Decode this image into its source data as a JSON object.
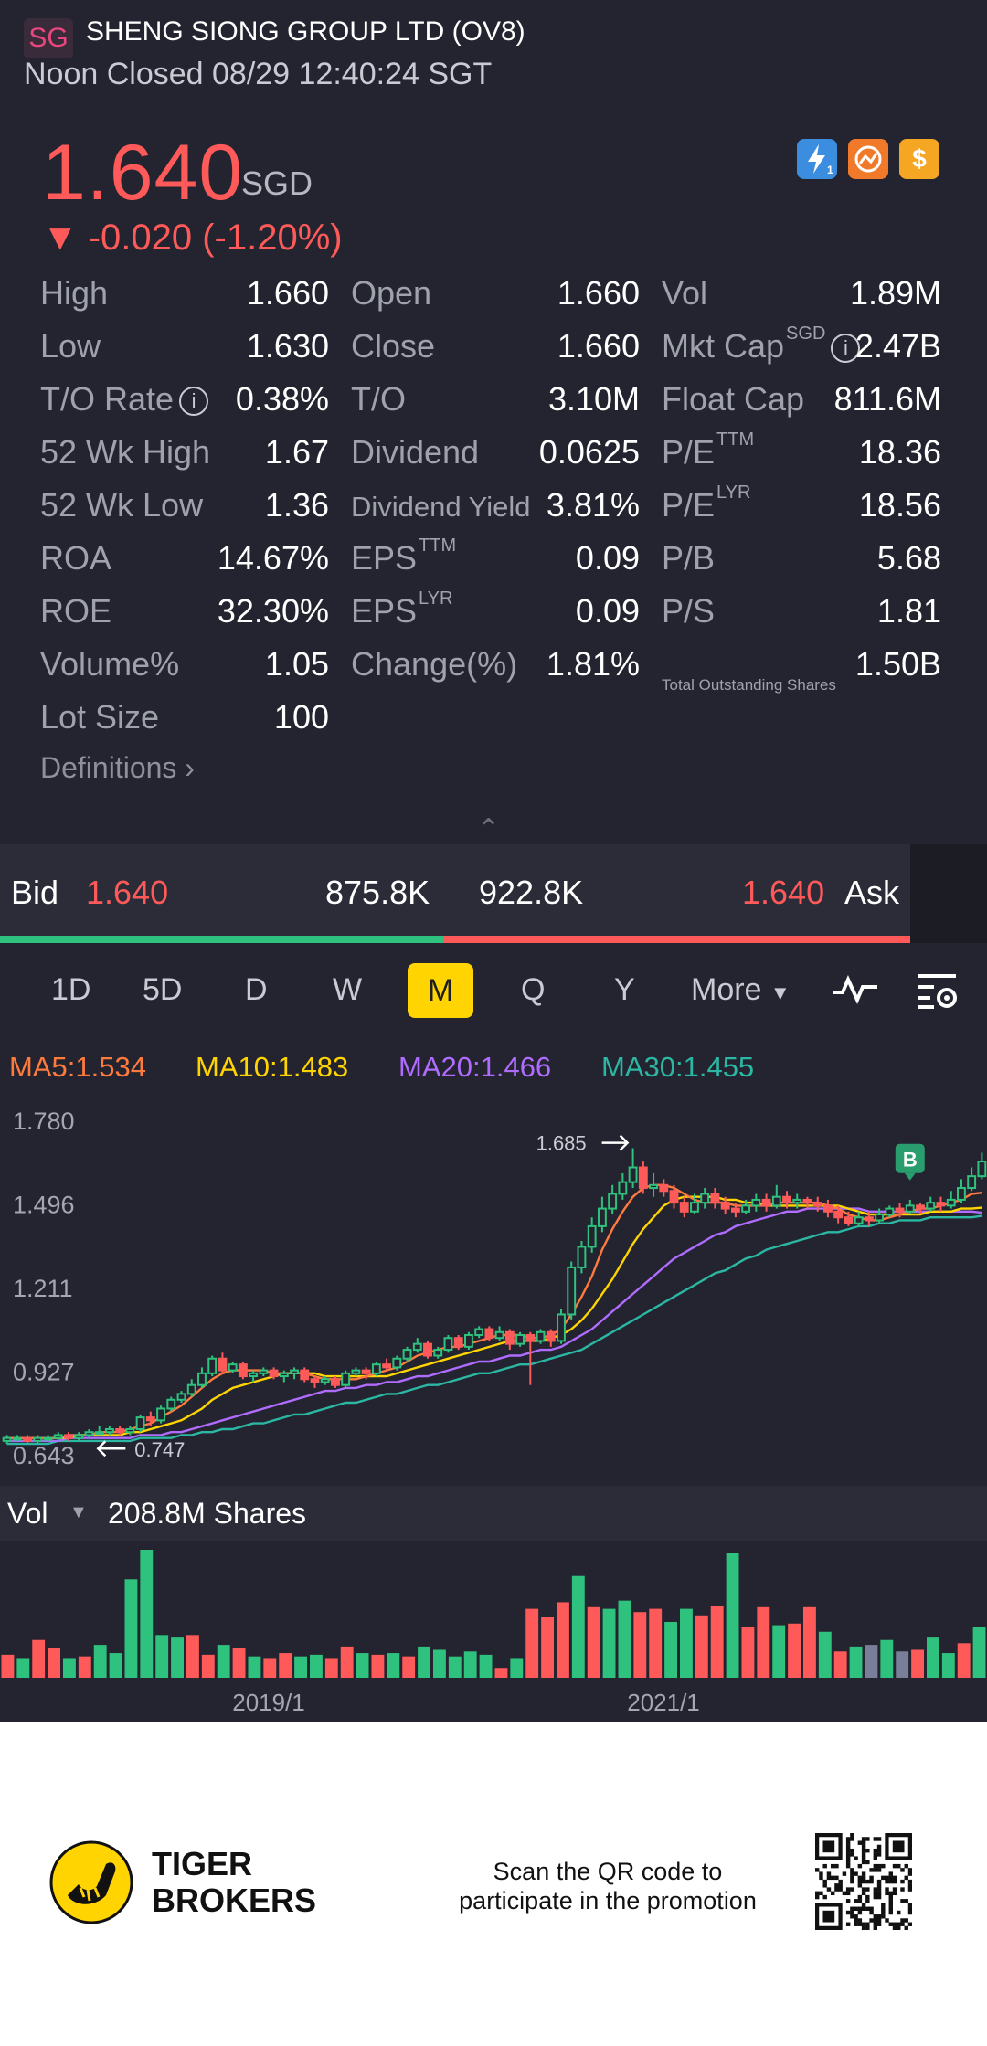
{
  "header": {
    "logo_text": "SG",
    "title": "SHENG SIONG GROUP LTD (OV8)",
    "status": "Noon Closed 08/29 12:40:24 SGT"
  },
  "quote": {
    "price": "1.640",
    "currency": "SGD",
    "change": "▼ -0.020 (-1.20%)",
    "badges": [
      {
        "name": "lightning-level1-icon",
        "color": "#3b8de0"
      },
      {
        "name": "options-icon",
        "color": "#f07a2a"
      },
      {
        "name": "dollar-icon",
        "color": "#f5a623"
      }
    ]
  },
  "stats": {
    "col1": [
      {
        "label": "High",
        "value": "1.660"
      },
      {
        "label": "Low",
        "value": "1.630"
      },
      {
        "label": "T/O Rate",
        "value": "0.38%"
      },
      {
        "label": "52 Wk High",
        "value": "1.67"
      },
      {
        "label": "52 Wk Low",
        "value": "1.36"
      },
      {
        "label": "ROA",
        "value": "14.67%"
      },
      {
        "label": "ROE",
        "value": "32.30%"
      },
      {
        "label": "Volume%",
        "value": "1.05"
      },
      {
        "label": "Lot Size",
        "value": "100"
      }
    ],
    "col2": [
      {
        "label": "Open",
        "value": "1.660"
      },
      {
        "label": "Close",
        "value": "1.660"
      },
      {
        "label": "T/O",
        "value": "3.10M"
      },
      {
        "label": "Dividend",
        "value": "0.0625"
      },
      {
        "label": "Dividend Yield",
        "value": "3.81%"
      },
      {
        "label": "EPS",
        "sup": "TTM",
        "value": "0.09"
      },
      {
        "label": "EPS",
        "sup": "LYR",
        "value": "0.09"
      },
      {
        "label": "Change(%)",
        "value": "1.81%"
      }
    ],
    "col3": [
      {
        "label": "Vol",
        "value": "1.89M"
      },
      {
        "label": "Mkt Cap",
        "sup": "SGD",
        "value": "2.47B"
      },
      {
        "label": "Float Cap",
        "value": "811.6M"
      },
      {
        "label": "P/E",
        "sup": "TTM",
        "value": "18.36"
      },
      {
        "label": "P/E",
        "sup": "LYR",
        "value": "18.56"
      },
      {
        "label": "P/B",
        "value": "5.68"
      },
      {
        "label": "P/S",
        "value": "1.81"
      },
      {
        "label": "Total Outstanding Shares",
        "value": "1.50B"
      }
    ],
    "definitions_label": "Definitions"
  },
  "bidask": {
    "bid_label": "Bid",
    "bid_price": "1.640",
    "bid_size": "875.8K",
    "ask_size": "922.8K",
    "ask_price": "1.640",
    "ask_label": "Ask",
    "bid_ratio": 0.487
  },
  "periods": {
    "items": [
      "1D",
      "5D",
      "D",
      "W",
      "M",
      "Q",
      "Y",
      "More"
    ],
    "selected": "M"
  },
  "ma": [
    {
      "label": "MA5:1.534",
      "color": "#ff7a3d"
    },
    {
      "label": "MA10:1.483",
      "color": "#ffd400"
    },
    {
      "label": "MA20:1.466",
      "color": "#b06cff"
    },
    {
      "label": "MA30:1.455",
      "color": "#2bb7a3"
    }
  ],
  "chart_data": {
    "type": "candlestick",
    "y_ticks": [
      "1.780",
      "1.496",
      "1.211",
      "0.927",
      "0.643"
    ],
    "ylim": [
      0.643,
      1.78
    ],
    "high_annotation": "1.685",
    "low_annotation": "0.747",
    "marker_label": "B",
    "x_labels": [
      "2019/1",
      "2021/1"
    ],
    "candles": [
      [
        0.69,
        0.7,
        0.68,
        0.71
      ],
      [
        0.7,
        0.7,
        0.69,
        0.71
      ],
      [
        0.7,
        0.69,
        0.68,
        0.71
      ],
      [
        0.69,
        0.7,
        0.68,
        0.71
      ],
      [
        0.7,
        0.7,
        0.69,
        0.71
      ],
      [
        0.7,
        0.71,
        0.69,
        0.72
      ],
      [
        0.71,
        0.7,
        0.69,
        0.72
      ],
      [
        0.7,
        0.71,
        0.69,
        0.72
      ],
      [
        0.71,
        0.72,
        0.7,
        0.73
      ],
      [
        0.72,
        0.72,
        0.71,
        0.74
      ],
      [
        0.72,
        0.73,
        0.71,
        0.74
      ],
      [
        0.73,
        0.72,
        0.71,
        0.74
      ],
      [
        0.72,
        0.73,
        0.71,
        0.74
      ],
      [
        0.73,
        0.77,
        0.72,
        0.78
      ],
      [
        0.77,
        0.76,
        0.74,
        0.79
      ],
      [
        0.76,
        0.8,
        0.75,
        0.81
      ],
      [
        0.8,
        0.83,
        0.79,
        0.84
      ],
      [
        0.83,
        0.85,
        0.82,
        0.86
      ],
      [
        0.85,
        0.88,
        0.84,
        0.9
      ],
      [
        0.88,
        0.92,
        0.87,
        0.94
      ],
      [
        0.92,
        0.97,
        0.91,
        0.98
      ],
      [
        0.97,
        0.93,
        0.92,
        0.99
      ],
      [
        0.93,
        0.95,
        0.92,
        0.96
      ],
      [
        0.95,
        0.91,
        0.9,
        0.96
      ],
      [
        0.91,
        0.92,
        0.89,
        0.93
      ],
      [
        0.92,
        0.93,
        0.91,
        0.94
      ],
      [
        0.93,
        0.91,
        0.9,
        0.94
      ],
      [
        0.91,
        0.92,
        0.89,
        0.93
      ],
      [
        0.92,
        0.93,
        0.9,
        0.94
      ],
      [
        0.93,
        0.9,
        0.89,
        0.94
      ],
      [
        0.9,
        0.89,
        0.87,
        0.91
      ],
      [
        0.89,
        0.9,
        0.88,
        0.91
      ],
      [
        0.9,
        0.88,
        0.87,
        0.91
      ],
      [
        0.88,
        0.92,
        0.87,
        0.93
      ],
      [
        0.92,
        0.93,
        0.91,
        0.94
      ],
      [
        0.93,
        0.92,
        0.9,
        0.94
      ],
      [
        0.92,
        0.95,
        0.91,
        0.96
      ],
      [
        0.95,
        0.94,
        0.93,
        0.97
      ],
      [
        0.94,
        0.97,
        0.93,
        0.98
      ],
      [
        0.97,
        1.0,
        0.96,
        1.01
      ],
      [
        1.0,
        1.02,
        0.99,
        1.04
      ],
      [
        1.02,
        0.98,
        0.97,
        1.03
      ],
      [
        0.98,
        1.0,
        0.97,
        1.01
      ],
      [
        1.0,
        1.04,
        0.99,
        1.05
      ],
      [
        1.04,
        1.01,
        1.0,
        1.05
      ],
      [
        1.01,
        1.05,
        1.0,
        1.06
      ],
      [
        1.05,
        1.07,
        1.04,
        1.08
      ],
      [
        1.07,
        1.04,
        1.03,
        1.08
      ],
      [
        1.04,
        1.06,
        1.03,
        1.08
      ],
      [
        1.06,
        1.02,
        1.0,
        1.07
      ],
      [
        1.02,
        1.05,
        1.01,
        1.06
      ],
      [
        1.05,
        1.03,
        0.88,
        1.06
      ],
      [
        1.03,
        1.06,
        1.02,
        1.07
      ],
      [
        1.06,
        1.03,
        1.01,
        1.07
      ],
      [
        1.03,
        1.12,
        1.02,
        1.14
      ],
      [
        1.12,
        1.28,
        1.1,
        1.3
      ],
      [
        1.28,
        1.35,
        1.26,
        1.37
      ],
      [
        1.35,
        1.42,
        1.33,
        1.45
      ],
      [
        1.42,
        1.48,
        1.4,
        1.52
      ],
      [
        1.48,
        1.53,
        1.46,
        1.56
      ],
      [
        1.53,
        1.57,
        1.51,
        1.6
      ],
      [
        1.57,
        1.62,
        1.55,
        1.685
      ],
      [
        1.62,
        1.55,
        1.53,
        1.64
      ],
      [
        1.55,
        1.56,
        1.52,
        1.6
      ],
      [
        1.56,
        1.54,
        1.52,
        1.58
      ],
      [
        1.54,
        1.5,
        1.48,
        1.56
      ],
      [
        1.5,
        1.47,
        1.45,
        1.52
      ],
      [
        1.47,
        1.5,
        1.46,
        1.53
      ],
      [
        1.5,
        1.53,
        1.48,
        1.55
      ],
      [
        1.53,
        1.5,
        1.48,
        1.55
      ],
      [
        1.5,
        1.48,
        1.46,
        1.52
      ],
      [
        1.48,
        1.47,
        1.45,
        1.5
      ],
      [
        1.47,
        1.49,
        1.46,
        1.51
      ],
      [
        1.49,
        1.51,
        1.47,
        1.53
      ],
      [
        1.51,
        1.49,
        1.47,
        1.53
      ],
      [
        1.49,
        1.52,
        1.48,
        1.56
      ],
      [
        1.52,
        1.5,
        1.48,
        1.54
      ],
      [
        1.5,
        1.51,
        1.48,
        1.53
      ],
      [
        1.51,
        1.5,
        1.48,
        1.52
      ],
      [
        1.5,
        1.49,
        1.47,
        1.52
      ],
      [
        1.49,
        1.47,
        1.45,
        1.51
      ],
      [
        1.47,
        1.45,
        1.43,
        1.49
      ],
      [
        1.45,
        1.43,
        1.42,
        1.47
      ],
      [
        1.43,
        1.45,
        1.42,
        1.47
      ],
      [
        1.45,
        1.44,
        1.42,
        1.47
      ],
      [
        1.44,
        1.46,
        1.43,
        1.48
      ],
      [
        1.46,
        1.48,
        1.45,
        1.49
      ],
      [
        1.48,
        1.47,
        1.45,
        1.5
      ],
      [
        1.47,
        1.49,
        1.46,
        1.51
      ],
      [
        1.49,
        1.48,
        1.46,
        1.5
      ],
      [
        1.48,
        1.5,
        1.47,
        1.52
      ],
      [
        1.5,
        1.49,
        1.47,
        1.52
      ],
      [
        1.49,
        1.51,
        1.48,
        1.54
      ],
      [
        1.51,
        1.55,
        1.5,
        1.58
      ],
      [
        1.55,
        1.59,
        1.54,
        1.62
      ],
      [
        1.59,
        1.64,
        1.58,
        1.67
      ]
    ],
    "ma5": [
      0.7,
      0.7,
      0.7,
      0.7,
      0.7,
      0.7,
      0.71,
      0.71,
      0.71,
      0.72,
      0.72,
      0.72,
      0.73,
      0.74,
      0.75,
      0.77,
      0.79,
      0.81,
      0.84,
      0.87,
      0.9,
      0.92,
      0.93,
      0.93,
      0.93,
      0.93,
      0.92,
      0.92,
      0.92,
      0.92,
      0.91,
      0.9,
      0.9,
      0.9,
      0.9,
      0.91,
      0.92,
      0.93,
      0.94,
      0.96,
      0.98,
      0.99,
      1.0,
      1.01,
      1.01,
      1.02,
      1.03,
      1.04,
      1.05,
      1.05,
      1.05,
      1.04,
      1.04,
      1.05,
      1.07,
      1.12,
      1.18,
      1.25,
      1.34,
      1.41,
      1.47,
      1.52,
      1.55,
      1.56,
      1.56,
      1.55,
      1.53,
      1.51,
      1.5,
      1.5,
      1.5,
      1.49,
      1.49,
      1.49,
      1.49,
      1.5,
      1.5,
      1.5,
      1.5,
      1.5,
      1.49,
      1.48,
      1.46,
      1.45,
      1.44,
      1.44,
      1.45,
      1.46,
      1.47,
      1.48,
      1.48,
      1.49,
      1.5,
      1.51,
      1.53,
      1.534
    ],
    "ma10": [
      0.7,
      0.7,
      0.7,
      0.7,
      0.7,
      0.7,
      0.7,
      0.71,
      0.71,
      0.71,
      0.71,
      0.71,
      0.72,
      0.72,
      0.73,
      0.74,
      0.75,
      0.76,
      0.78,
      0.8,
      0.83,
      0.85,
      0.87,
      0.88,
      0.89,
      0.9,
      0.91,
      0.92,
      0.92,
      0.92,
      0.92,
      0.91,
      0.91,
      0.91,
      0.91,
      0.91,
      0.91,
      0.91,
      0.92,
      0.93,
      0.94,
      0.95,
      0.96,
      0.97,
      0.98,
      0.99,
      1.0,
      1.01,
      1.02,
      1.03,
      1.03,
      1.03,
      1.03,
      1.04,
      1.05,
      1.07,
      1.1,
      1.14,
      1.19,
      1.24,
      1.3,
      1.36,
      1.41,
      1.45,
      1.49,
      1.51,
      1.52,
      1.52,
      1.52,
      1.52,
      1.51,
      1.51,
      1.5,
      1.5,
      1.49,
      1.49,
      1.49,
      1.49,
      1.49,
      1.49,
      1.49,
      1.49,
      1.48,
      1.47,
      1.46,
      1.46,
      1.46,
      1.46,
      1.46,
      1.46,
      1.47,
      1.47,
      1.47,
      1.48,
      1.48,
      1.483
    ],
    "ma20": [
      0.69,
      0.69,
      0.69,
      0.69,
      0.69,
      0.69,
      0.7,
      0.7,
      0.7,
      0.7,
      0.7,
      0.7,
      0.7,
      0.71,
      0.71,
      0.71,
      0.72,
      0.72,
      0.73,
      0.74,
      0.75,
      0.76,
      0.77,
      0.78,
      0.79,
      0.8,
      0.81,
      0.82,
      0.83,
      0.84,
      0.85,
      0.86,
      0.86,
      0.87,
      0.87,
      0.88,
      0.88,
      0.89,
      0.89,
      0.9,
      0.91,
      0.91,
      0.92,
      0.93,
      0.94,
      0.95,
      0.96,
      0.96,
      0.97,
      0.98,
      0.98,
      0.99,
      1.0,
      1.0,
      1.01,
      1.03,
      1.05,
      1.07,
      1.1,
      1.13,
      1.16,
      1.19,
      1.22,
      1.25,
      1.28,
      1.31,
      1.33,
      1.35,
      1.37,
      1.39,
      1.4,
      1.42,
      1.43,
      1.44,
      1.45,
      1.46,
      1.47,
      1.47,
      1.48,
      1.48,
      1.48,
      1.48,
      1.48,
      1.48,
      1.47,
      1.47,
      1.47,
      1.47,
      1.47,
      1.47,
      1.47,
      1.47,
      1.47,
      1.47,
      1.47,
      1.466
    ],
    "ma30": [
      0.68,
      0.68,
      0.68,
      0.68,
      0.68,
      0.69,
      0.69,
      0.69,
      0.69,
      0.69,
      0.69,
      0.69,
      0.69,
      0.7,
      0.7,
      0.7,
      0.7,
      0.71,
      0.71,
      0.72,
      0.72,
      0.73,
      0.73,
      0.74,
      0.75,
      0.75,
      0.76,
      0.77,
      0.78,
      0.78,
      0.79,
      0.8,
      0.81,
      0.82,
      0.82,
      0.83,
      0.84,
      0.85,
      0.85,
      0.86,
      0.87,
      0.88,
      0.88,
      0.89,
      0.9,
      0.91,
      0.92,
      0.92,
      0.93,
      0.94,
      0.95,
      0.95,
      0.96,
      0.97,
      0.98,
      0.99,
      1.0,
      1.02,
      1.04,
      1.06,
      1.08,
      1.1,
      1.12,
      1.14,
      1.16,
      1.18,
      1.2,
      1.22,
      1.24,
      1.26,
      1.27,
      1.29,
      1.31,
      1.32,
      1.34,
      1.35,
      1.36,
      1.37,
      1.38,
      1.39,
      1.4,
      1.4,
      1.41,
      1.42,
      1.42,
      1.43,
      1.43,
      1.44,
      1.44,
      1.44,
      1.45,
      1.45,
      1.45,
      1.45,
      1.45,
      1.455
    ],
    "volume_label": "Vol",
    "volume_value": "208.8M Shares",
    "volumes": [
      [
        0.14,
        "r"
      ],
      [
        0.12,
        "g"
      ],
      [
        0.23,
        "r"
      ],
      [
        0.18,
        "r"
      ],
      [
        0.12,
        "g"
      ],
      [
        0.13,
        "r"
      ],
      [
        0.2,
        "g"
      ],
      [
        0.15,
        "g"
      ],
      [
        0.6,
        "g"
      ],
      [
        0.78,
        "g"
      ],
      [
        0.26,
        "g"
      ],
      [
        0.25,
        "g"
      ],
      [
        0.26,
        "r"
      ],
      [
        0.14,
        "r"
      ],
      [
        0.2,
        "g"
      ],
      [
        0.18,
        "r"
      ],
      [
        0.13,
        "g"
      ],
      [
        0.12,
        "r"
      ],
      [
        0.15,
        "r"
      ],
      [
        0.13,
        "g"
      ],
      [
        0.14,
        "g"
      ],
      [
        0.12,
        "r"
      ],
      [
        0.19,
        "r"
      ],
      [
        0.15,
        "g"
      ],
      [
        0.14,
        "r"
      ],
      [
        0.15,
        "g"
      ],
      [
        0.13,
        "r"
      ],
      [
        0.19,
        "g"
      ],
      [
        0.17,
        "g"
      ],
      [
        0.13,
        "g"
      ],
      [
        0.16,
        "g"
      ],
      [
        0.14,
        "g"
      ],
      [
        0.06,
        "r"
      ],
      [
        0.12,
        "g"
      ],
      [
        0.42,
        "r"
      ],
      [
        0.37,
        "r"
      ],
      [
        0.46,
        "r"
      ],
      [
        0.62,
        "g"
      ],
      [
        0.43,
        "r"
      ],
      [
        0.42,
        "g"
      ],
      [
        0.47,
        "g"
      ],
      [
        0.4,
        "r"
      ],
      [
        0.42,
        "r"
      ],
      [
        0.34,
        "g"
      ],
      [
        0.42,
        "g"
      ],
      [
        0.38,
        "r"
      ],
      [
        0.44,
        "r"
      ],
      [
        0.76,
        "g"
      ],
      [
        0.31,
        "r"
      ],
      [
        0.43,
        "r"
      ],
      [
        0.32,
        "g"
      ],
      [
        0.33,
        "r"
      ],
      [
        0.43,
        "r"
      ],
      [
        0.28,
        "g"
      ],
      [
        0.16,
        "r"
      ],
      [
        0.19,
        "g"
      ],
      [
        0.2,
        "x"
      ],
      [
        0.23,
        "g"
      ],
      [
        0.16,
        "x"
      ],
      [
        0.17,
        "r"
      ],
      [
        0.25,
        "g"
      ],
      [
        0.15,
        "g"
      ],
      [
        0.21,
        "r"
      ],
      [
        0.31,
        "g"
      ]
    ]
  },
  "footer": {
    "brand_line1": "TIGER",
    "brand_line2": "BROKERS",
    "promo_line1": "Scan the QR code to",
    "promo_line2": "participate in the promotion"
  }
}
